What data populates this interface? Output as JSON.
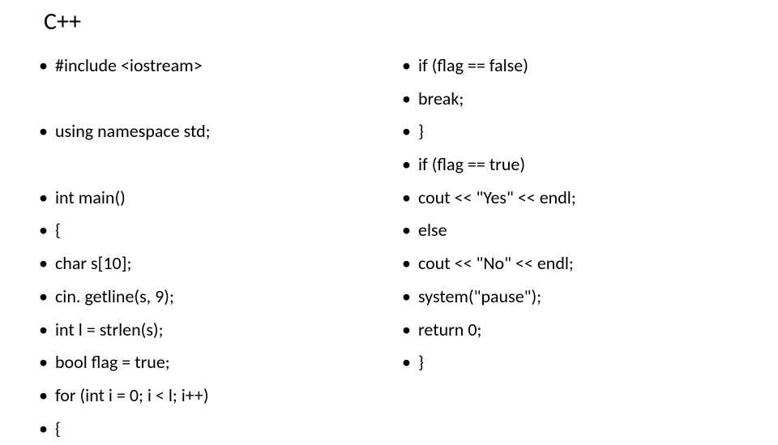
{
  "title": "C++",
  "left": [
    "#include <iostream>",
    "",
    "using namespace std;",
    "",
    "int main()",
    "{",
    "char s[10];",
    "cin. getline(s, 9);",
    "int l = strlen(s);",
    "bool flag = true;",
    "for (int i = 0; i < l; i++)",
    "{"
  ],
  "right": [
    "if (flag == false)",
    "break;",
    "}",
    "if (flag == true)",
    "cout << \"Yes\" << endl;",
    "else",
    "cout << \"No\" << endl;",
    "system(\"pause\");",
    "return 0;",
    "}"
  ]
}
